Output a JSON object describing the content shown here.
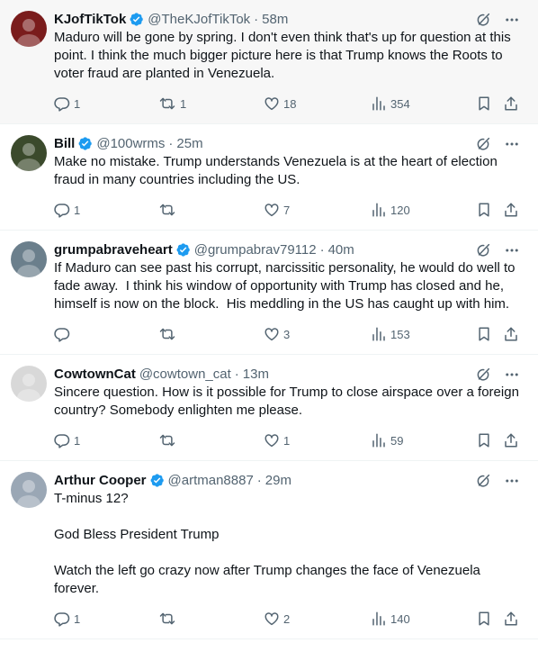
{
  "tweets": [
    {
      "name": "KJofTikTok",
      "handle": "@TheKJofTikTok",
      "sep": "·",
      "time": "58m",
      "verified": true,
      "avatar_color": "#7a1c1c",
      "avatar_icon": "flag-avatar",
      "text": "Maduro will be gone by spring. I don't even think that's up for question at this point. I think the much bigger picture here is that Trump knows the Roots to voter fraud are planted in Venezuela.",
      "replies": "1",
      "reposts": "1",
      "likes": "18",
      "views": "354"
    },
    {
      "name": "Bill",
      "handle": "@100wrms",
      "sep": "·",
      "time": "25m",
      "verified": true,
      "avatar_color": "#3b4a2c",
      "text": "Make no mistake. Trump understands Venezuela is at the heart of election fraud in many countries including the US.",
      "replies": "1",
      "reposts": "",
      "likes": "7",
      "views": "120"
    },
    {
      "name": "grumpabraveheart",
      "handle": "@grumpabrav79112",
      "sep": "·",
      "time": "40m",
      "verified": true,
      "avatar_color": "#6b7f8c",
      "text": "If Maduro can see past his corrupt, narcissitic personality, he would do well to fade away.  I think his window of opportunity with Trump has closed and he, himself is now on the block.  His meddling in the US has caught up with him.",
      "replies": "",
      "reposts": "",
      "likes": "3",
      "views": "153"
    },
    {
      "name": "CowtownCat",
      "handle": "@cowtown_cat",
      "sep": "·",
      "time": "13m",
      "verified": false,
      "avatar_color": "#d8d8d8",
      "text": "Sincere question. How is it possible for Trump to close airspace over a foreign country? Somebody enlighten me please.",
      "replies": "1",
      "reposts": "",
      "likes": "1",
      "views": "59"
    },
    {
      "name": "Arthur Cooper",
      "handle": "@artman8887",
      "sep": "·",
      "time": "29m",
      "verified": true,
      "avatar_color": "#9aa7b5",
      "text": "T-minus 12?\n\nGod Bless President Trump\n\nWatch the left go crazy now after Trump changes the face of Venezuela forever.",
      "replies": "1",
      "reposts": "",
      "likes": "2",
      "views": "140"
    }
  ],
  "colors": {
    "verified": "#1d9bf0",
    "secondary_text": "#536471",
    "highlight_bg": "#f7f7f7",
    "divider": "#eff3f4"
  },
  "icons": [
    "grok-icon",
    "more-icon",
    "reply-icon",
    "repost-icon",
    "like-icon",
    "views-icon",
    "bookmark-icon",
    "share-icon",
    "verified-badge-icon"
  ]
}
